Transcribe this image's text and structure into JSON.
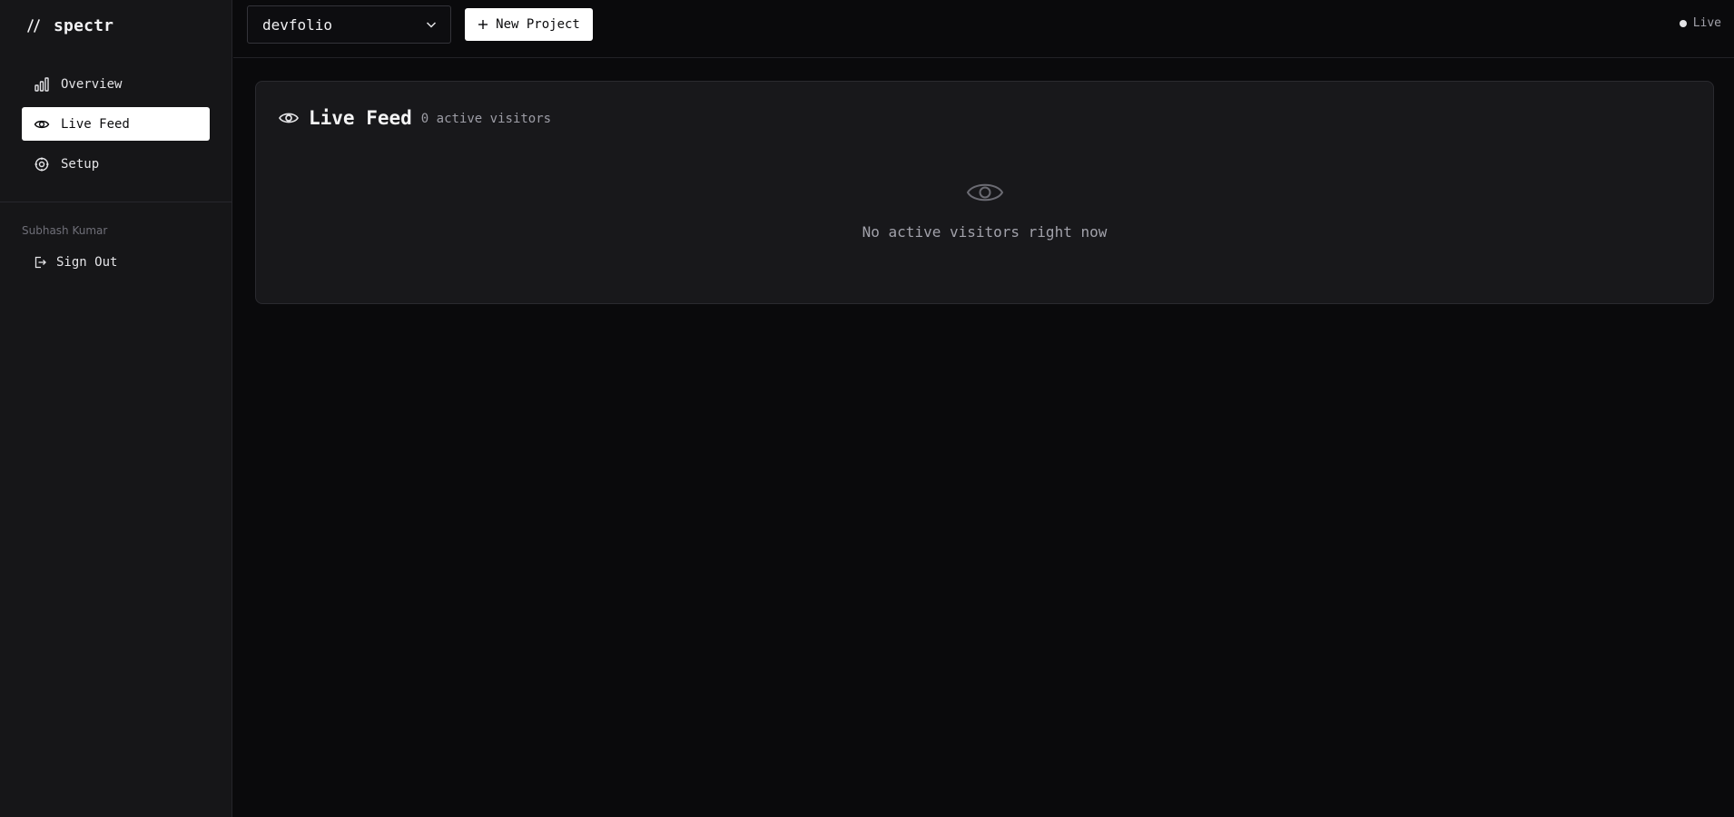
{
  "brand": {
    "name": "spectr",
    "mark_icon": "double-slash-logo"
  },
  "sidebar": {
    "items": [
      {
        "label": "Overview",
        "icon": "bar-chart-icon",
        "active": false
      },
      {
        "label": "Live Feed",
        "icon": "eye-icon",
        "active": true
      },
      {
        "label": "Setup",
        "icon": "gear-icon",
        "active": false
      }
    ],
    "user_name": "Subhash Kumar",
    "sign_out_label": "Sign Out"
  },
  "topbar": {
    "project_select": {
      "value": "devfolio",
      "icon": "chevron-down-icon"
    },
    "new_project_label": "New Project",
    "status_label": "Live"
  },
  "live_feed": {
    "title": "Live Feed",
    "count_label": "0 active visitors",
    "empty_message": "No active visitors right now"
  },
  "colors": {
    "background": "#0a0a0c",
    "sidebar": "#161618",
    "card": "#18181b",
    "active_nav": "#ffffff",
    "muted_text": "#a1a1aa"
  }
}
